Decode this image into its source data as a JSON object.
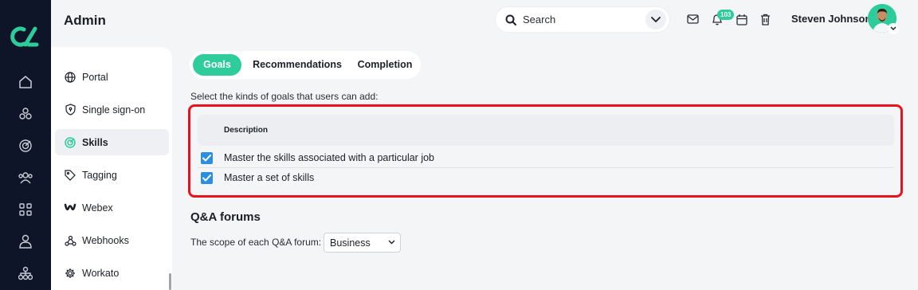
{
  "app": {
    "title": "Admin"
  },
  "header": {
    "search_placeholder": "Search",
    "notification_count": "103",
    "user_name": "Steven Johnson",
    "icons": [
      "search-icon",
      "chevron-down-icon",
      "mail-icon",
      "bell-icon",
      "calendar-icon",
      "trash-icon"
    ]
  },
  "rail": {
    "icons": [
      "logo",
      "home-icon",
      "cubes-icon",
      "target-icon",
      "people-icon",
      "apps-icon",
      "user-icon",
      "org-chart-icon"
    ]
  },
  "menu": {
    "items": [
      {
        "label": "Portal",
        "icon": "globe-icon"
      },
      {
        "label": "Single sign-on",
        "icon": "shield-icon"
      },
      {
        "label": "Skills",
        "icon": "skills-target-icon",
        "active": true
      },
      {
        "label": "Tagging",
        "icon": "tag-icon"
      },
      {
        "label": "Webex",
        "icon": "webex-icon"
      },
      {
        "label": "Webhooks",
        "icon": "webhooks-icon"
      },
      {
        "label": "Workato",
        "icon": "gear-icon"
      }
    ]
  },
  "tabs": [
    {
      "label": "Goals",
      "active": true
    },
    {
      "label": "Recommendations"
    },
    {
      "label": "Completion"
    }
  ],
  "goals": {
    "instruction": "Select the kinds of goals that users can add:",
    "column_header": "Description",
    "rows": [
      {
        "label": "Master the skills associated with a particular job",
        "checked": true
      },
      {
        "label": "Master a set of skills",
        "checked": true
      }
    ]
  },
  "qa": {
    "title": "Q&A forums",
    "scope_label": "The scope of each Q&A forum:",
    "scope_value": "Business"
  },
  "colors": {
    "accent": "#2ecc9a",
    "rail": "#0e1528",
    "checkbox": "#2b8ee0",
    "highlight": "#e8121e"
  }
}
